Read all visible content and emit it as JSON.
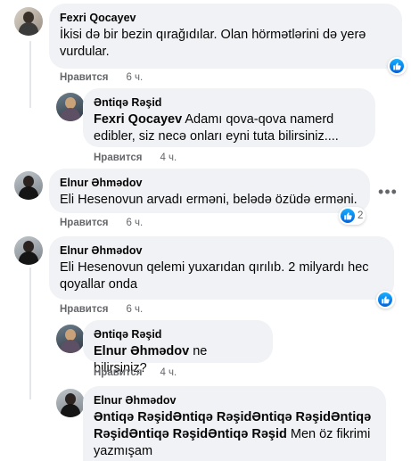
{
  "comments": [
    {
      "author": "Fexri Qocayev",
      "text": "İkisi də bir bezin qırağıdılar. Olan hörmətlərini də yerə vurdular.",
      "like_label": "Нравится",
      "time": "6 ч.",
      "reactions": ""
    },
    {
      "author": "Əntiqə Rəşid",
      "mention": "Fexri Qocayev",
      "text": " Adamı qova-qova namerd edibler, siz necə onları eyni tuta bilirsiniz....",
      "like_label": "Нравится",
      "time": "4 ч."
    },
    {
      "author": "Elnur Əhmədov",
      "text": "Eli Hesenovun arvadı erməni, belədə özüdə erməni.",
      "like_label": "Нравится",
      "time": "6 ч.",
      "reactions": "2"
    },
    {
      "author": "Elnur Əhmədov",
      "text": "Eli Hesenovun qelemi yuxarıdan qırılıb. 2 milyardı hec qoyallar onda",
      "like_label": "Нравится",
      "time": "6 ч.",
      "reactions": ""
    },
    {
      "author": "Əntiqə Rəşid",
      "mention": "Elnur Əhmədov",
      "text": " ne bilirsiniz?",
      "like_label": "Нравится",
      "time": "4 ч."
    },
    {
      "author": "Elnur Əhmədov",
      "mention": "Əntiqə RəşidƏntiqə RəşidƏntiqə RəşidƏntiqə RəşidƏntiqə RəşidƏntiqə Rəşid",
      "text": " Men öz fikrimi yazmışam"
    }
  ],
  "icons": {
    "like": "like-icon",
    "more": "more-options-icon"
  },
  "colors": {
    "bubble": "#f0f2f5",
    "like_blue": "#1877f2",
    "meta_gray": "#65676b"
  }
}
